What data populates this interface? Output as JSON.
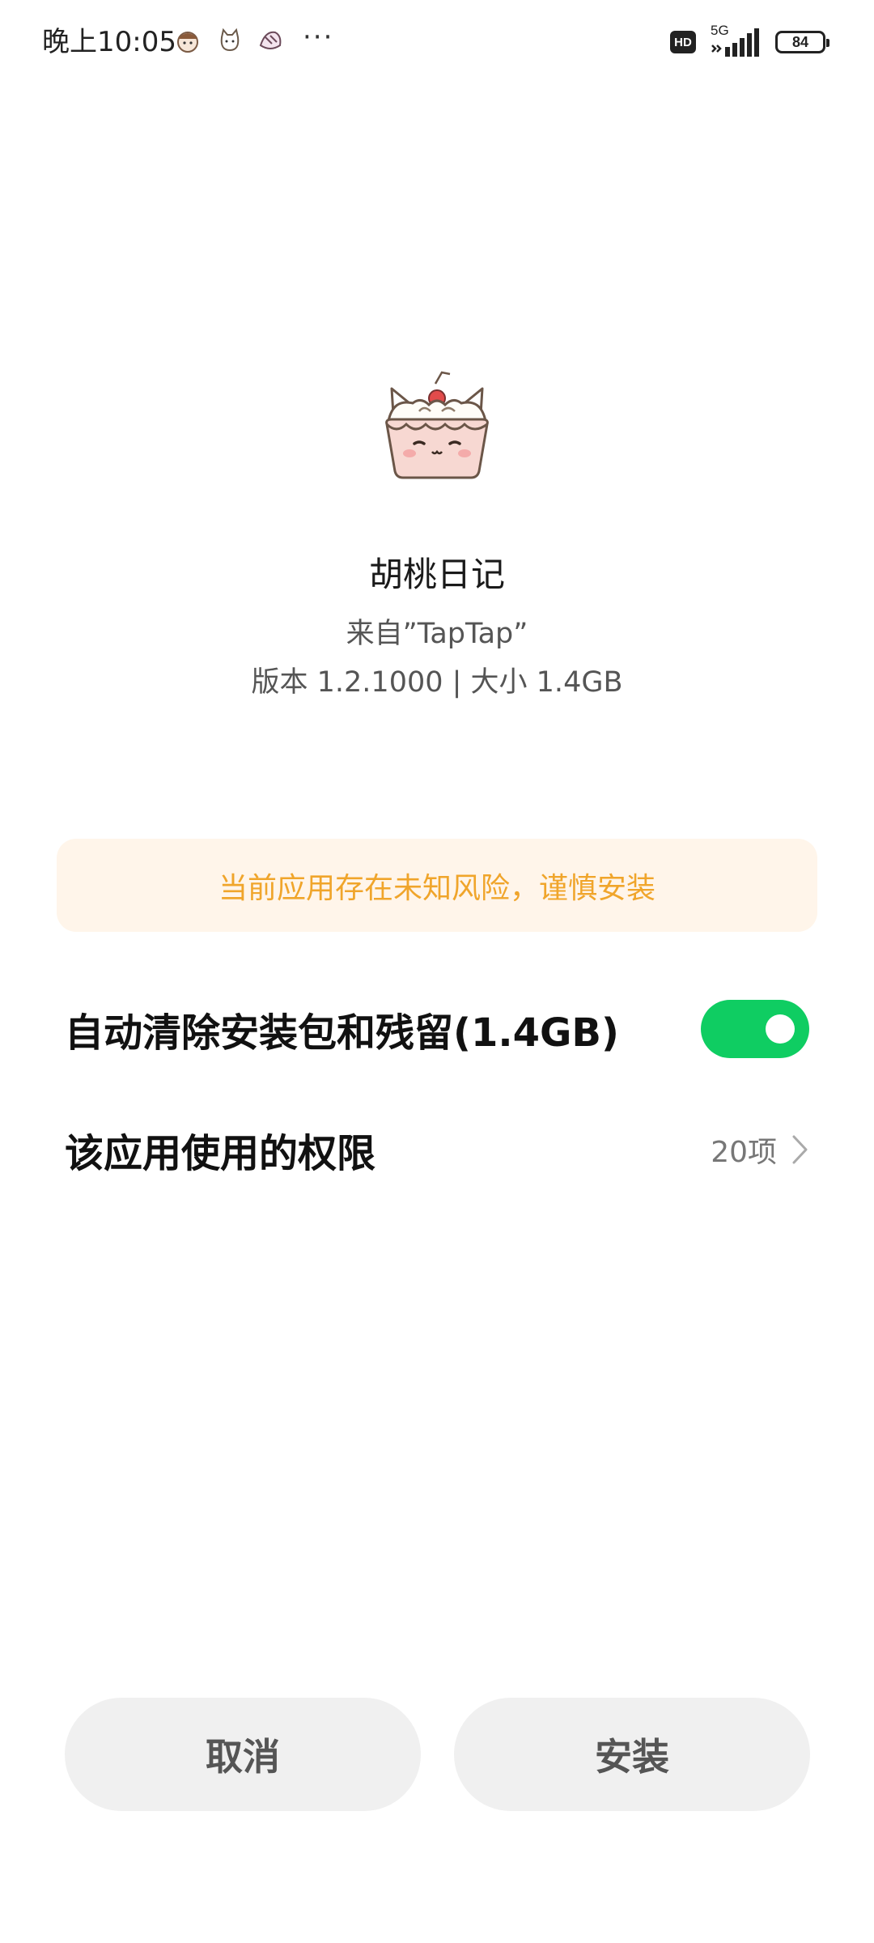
{
  "status_bar": {
    "time": "晚上10:05",
    "more": "···",
    "hd": "HD",
    "network": "5G",
    "battery": "84"
  },
  "app": {
    "icon": "cat-cupcake-icon",
    "name": "胡桃日记",
    "source": "来自”TapTap”",
    "meta": "版本 1.2.1000 | 大小 1.4GB"
  },
  "warning": {
    "text": "当前应用存在未知风险，谨慎安装",
    "color": "#f0a52b",
    "background": "#fff5ea"
  },
  "settings": {
    "auto_clean_label": "自动清除安装包和残留(1.4GB)",
    "auto_clean_enabled": true,
    "permissions_label": "该应用使用的权限",
    "permissions_count": "20项"
  },
  "buttons": {
    "cancel": "取消",
    "install": "安装"
  },
  "colors": {
    "toggle_on": "#0fcd62",
    "button_bg": "#f0f0f0"
  }
}
